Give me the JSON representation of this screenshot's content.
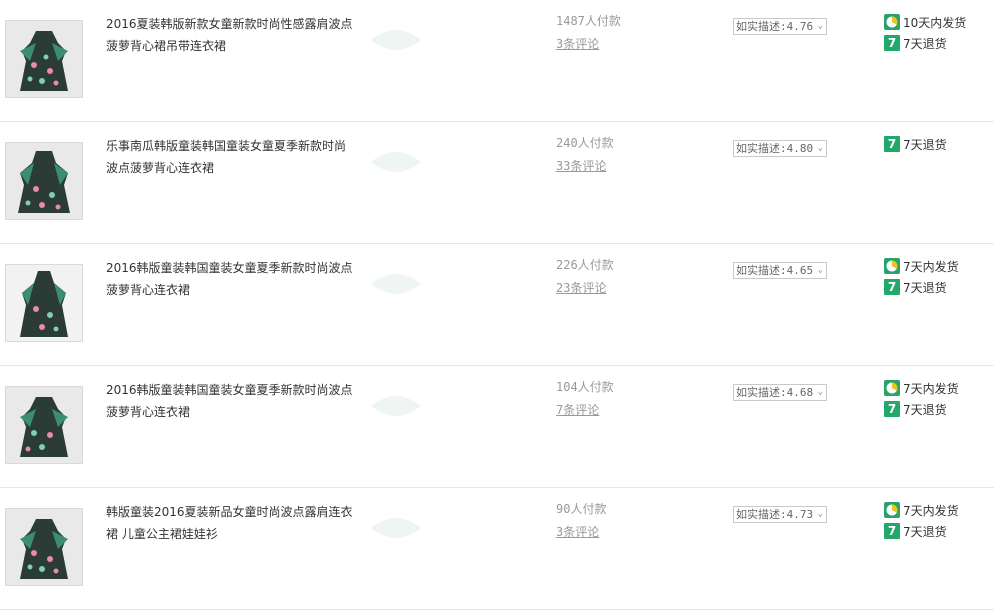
{
  "icons": {
    "ship": "clock-icon",
    "return": "seven-day-return-icon"
  },
  "colors": {
    "service_green": "#2aa36b",
    "muted_text": "#999999",
    "divider": "#e6e6e6"
  },
  "products": [
    {
      "title": "2016夏装韩版新款女童新款时尚性感露肩波点菠萝背心裙吊带连衣裙",
      "paid": "1487人付款",
      "comments": "3条评论",
      "rating": "如实描述:4.76",
      "services": [
        "10天内发货",
        "7天退货"
      ]
    },
    {
      "title": "乐事南瓜韩版童装韩国童装女童夏季新款时尚波点菠萝背心连衣裙",
      "paid": "240人付款",
      "comments": "33条评论",
      "rating": "如实描述:4.80",
      "services": [
        "7天退货"
      ]
    },
    {
      "title": "2016韩版童装韩国童装女童夏季新款时尚波点菠萝背心连衣裙",
      "paid": "226人付款",
      "comments": "23条评论",
      "rating": "如实描述:4.65",
      "services": [
        "7天内发货",
        "7天退货"
      ]
    },
    {
      "title": "2016韩版童装韩国童装女童夏季新款时尚波点菠萝背心连衣裙",
      "paid": "104人付款",
      "comments": "7条评论",
      "rating": "如实描述:4.68",
      "services": [
        "7天内发货",
        "7天退货"
      ]
    },
    {
      "title": "韩版童装2016夏装新品女童时尚波点露肩连衣裙 儿童公主裙娃娃衫",
      "paid": "90人付款",
      "comments": "3条评论",
      "rating": "如实描述:4.73",
      "services": [
        "7天内发货",
        "7天退货"
      ]
    }
  ]
}
